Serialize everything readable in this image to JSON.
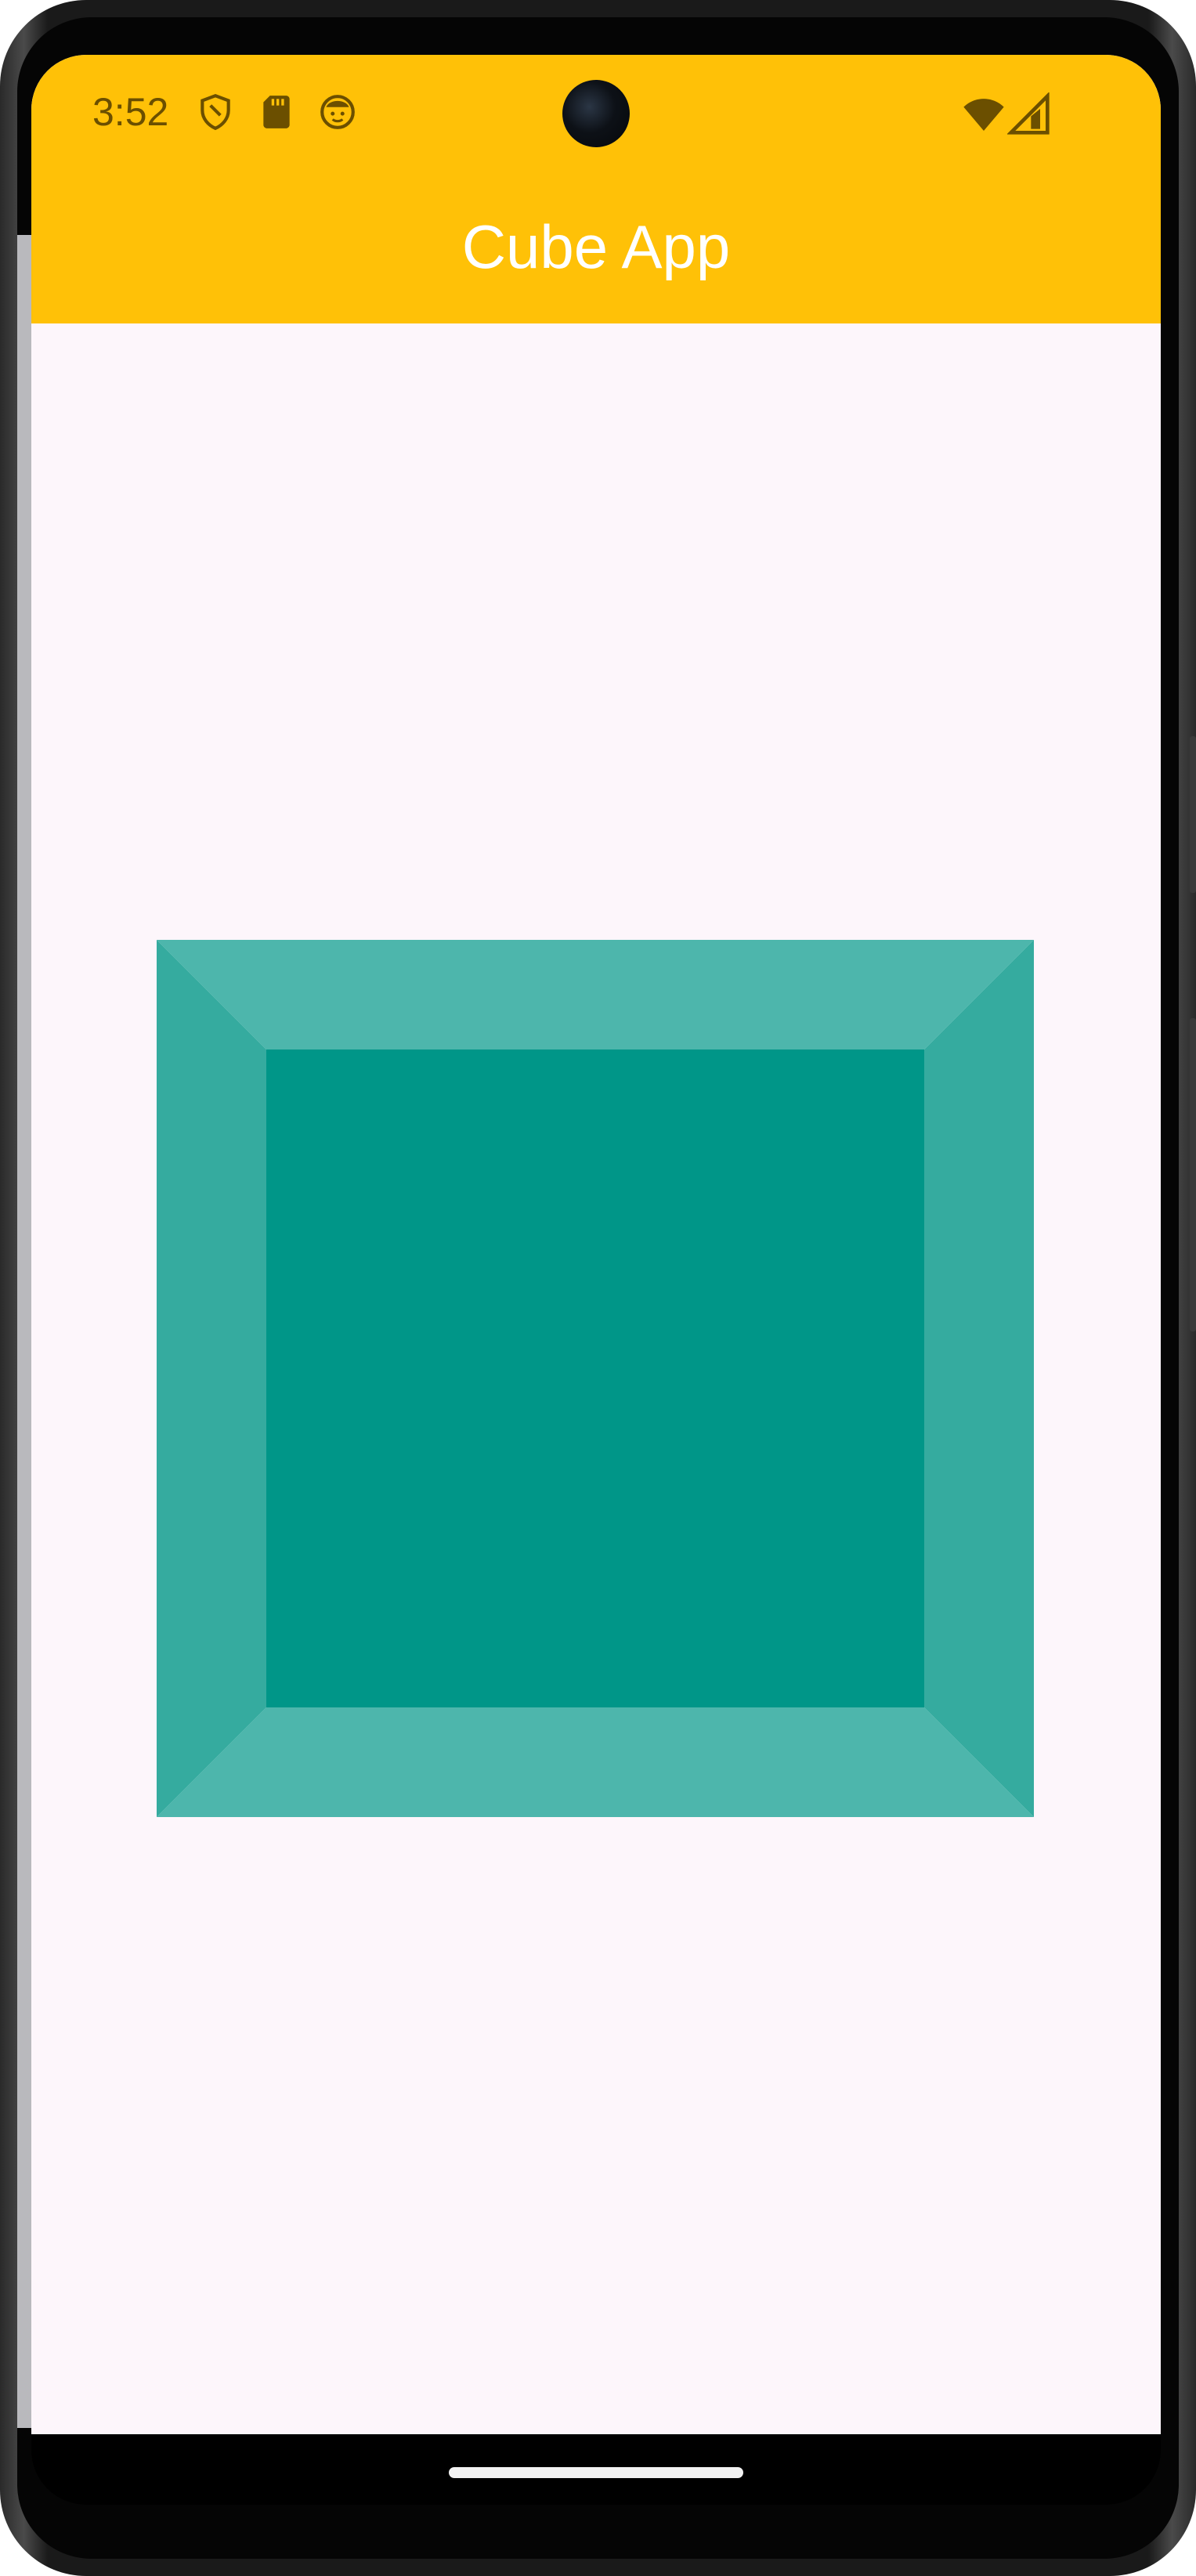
{
  "status_bar": {
    "time": "3:52",
    "icons": [
      "shield-icon",
      "sd-card-icon",
      "face-icon",
      "wifi-icon",
      "signal-icon"
    ]
  },
  "app_bar": {
    "title": "Cube App",
    "background": "#ffc107",
    "title_color": "#ffffff"
  },
  "cube": {
    "front_color": "#009688",
    "top_bottom_color": "#4db6ac",
    "side_color": "#35ab9f"
  },
  "screen_background": "#fdf6fb"
}
